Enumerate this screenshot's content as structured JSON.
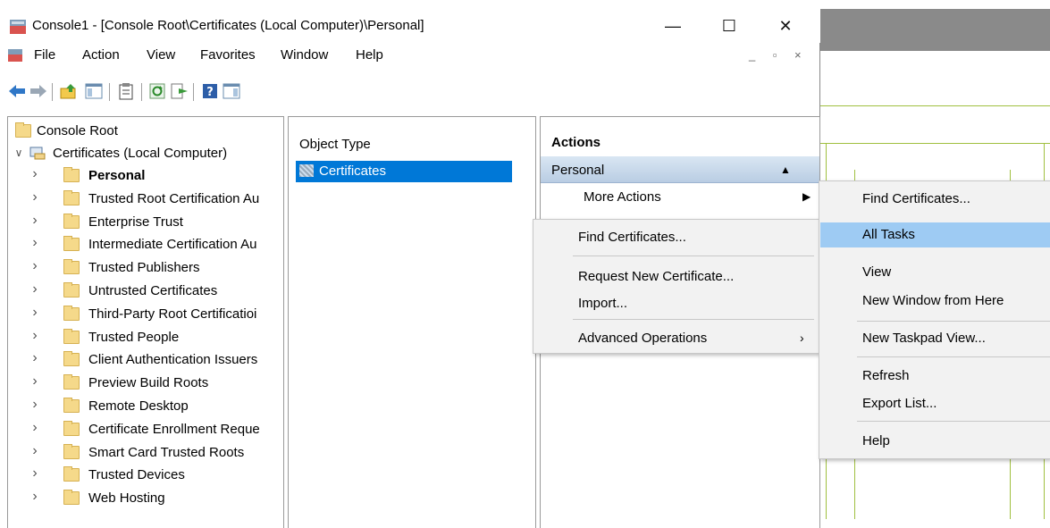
{
  "window": {
    "title": "Console1 - [Console Root\\Certificates (Local Computer)\\Personal]",
    "controls": {
      "minimize": "—",
      "maximize": "☐",
      "close": "✕"
    }
  },
  "menubar": {
    "items": [
      "File",
      "Action",
      "View",
      "Favorites",
      "Window",
      "Help"
    ],
    "mdi_controls": "_ ▫ ×"
  },
  "tree": {
    "root": "Console Root",
    "computer": "Certificates (Local Computer)",
    "stores": [
      "Personal",
      "Trusted Root Certification Au",
      "Enterprise Trust",
      "Intermediate Certification Au",
      "Trusted Publishers",
      "Untrusted Certificates",
      "Third-Party Root Certificatioi",
      "Trusted People",
      "Client Authentication Issuers",
      "Preview Build Roots",
      "Remote Desktop",
      "Certificate Enrollment Reque",
      "Smart Card Trusted Roots",
      "Trusted Devices",
      "Web Hosting"
    ]
  },
  "list": {
    "header": "Object Type",
    "rows": [
      "Certificates"
    ]
  },
  "actions": {
    "title": "Actions",
    "section": "Personal",
    "more_actions": "More Actions"
  },
  "menu_more_actions": {
    "items": [
      "Find Certificates...",
      "Request New Certificate...",
      "Import...",
      "Advanced Operations"
    ]
  },
  "menu_tasks": {
    "items": [
      "Find Certificates...",
      "All Tasks",
      "View",
      "New Window from Here",
      "New Taskpad View...",
      "Refresh",
      "Export List...",
      "Help"
    ],
    "highlighted": "All Tasks"
  },
  "colors": {
    "selection": "#0078d7",
    "menu_highlight": "#9ecbf3",
    "folder": "#f5d98a"
  }
}
